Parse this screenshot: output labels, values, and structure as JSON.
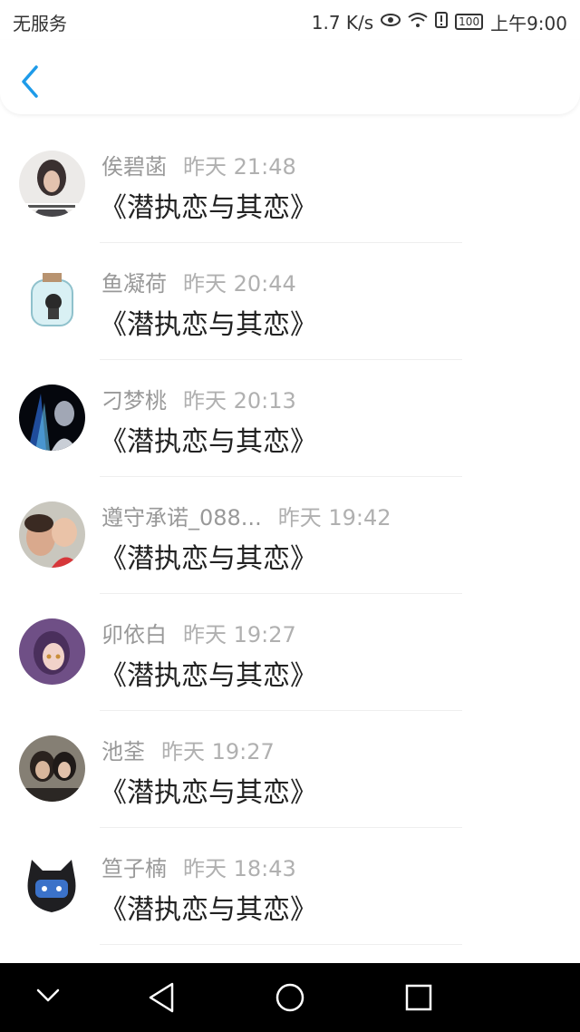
{
  "status_bar": {
    "carrier": "无服务",
    "speed": "1.7 K/s",
    "battery": "100",
    "time": "上午9:00"
  },
  "messages": [
    {
      "name": "俟碧菡",
      "time": "昨天 21:48",
      "text": "《潜执恋与其恋》"
    },
    {
      "name": "鱼凝荷",
      "time": "昨天 20:44",
      "text": "《潜执恋与其恋》"
    },
    {
      "name": "刁梦桃",
      "time": "昨天 20:13",
      "text": "《潜执恋与其恋》"
    },
    {
      "name": "遵守承诺_088...",
      "time": "昨天 19:42",
      "text": "《潜执恋与其恋》"
    },
    {
      "name": "卯依白",
      "time": "昨天 19:27",
      "text": "《潜执恋与其恋》"
    },
    {
      "name": "池荃",
      "time": "昨天 19:27",
      "text": "《潜执恋与其恋》"
    },
    {
      "name": "笪子楠",
      "time": "昨天 18:43",
      "text": "《潜执恋与其恋》"
    }
  ]
}
